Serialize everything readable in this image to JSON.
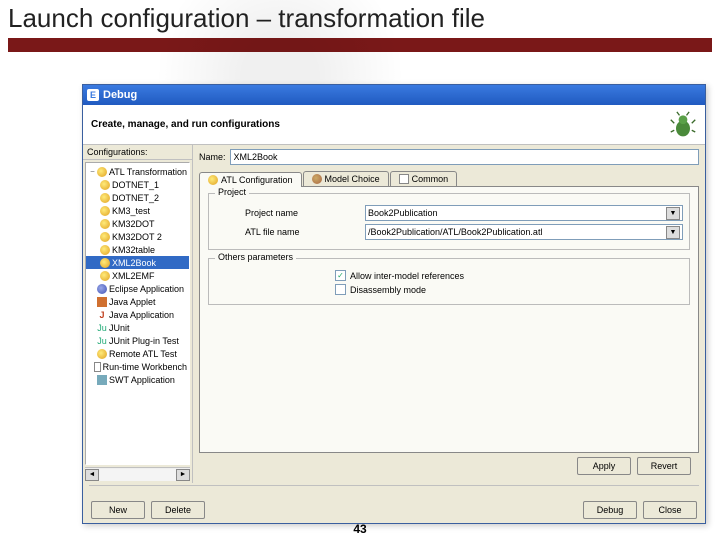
{
  "slide": {
    "title": "Launch configuration – transformation file",
    "page_number": "43"
  },
  "dialog": {
    "title": "Debug",
    "header": "Create, manage, and run configurations",
    "left": {
      "heading": "Configurations:",
      "tree": [
        {
          "label": "ATL Transformation",
          "children": [
            "DOTNET_1",
            "DOTNET_2",
            "KM3_test",
            "KM32DOT",
            "KM32DOT 2",
            "KM32table",
            "XML2Book",
            "XML2EMF"
          ]
        },
        {
          "label": "Eclipse Application"
        },
        {
          "label": "Java Applet"
        },
        {
          "label": "Java Application"
        },
        {
          "label": "JUnit"
        },
        {
          "label": "JUnit Plug-in Test"
        },
        {
          "label": "Remote ATL Test"
        },
        {
          "label": "Run-time Workbench"
        },
        {
          "label": "SWT Application"
        }
      ],
      "selected": "XML2Book"
    },
    "form": {
      "name_label": "Name:",
      "name_value": "XML2Book",
      "tabs": {
        "atl": "ATL Configuration",
        "model": "Model Choice",
        "common": "Common"
      },
      "project_group": "Project",
      "project_name_label": "Project name",
      "project_name_value": "Book2Publication",
      "atl_file_label": "ATL file name",
      "atl_file_value": "/Book2Publication/ATL/Book2Publication.atl",
      "other_group": "Others parameters",
      "chk1": "Allow inter-model references",
      "chk2": "Disassembly mode"
    },
    "buttons": {
      "new": "New",
      "delete": "Delete",
      "apply": "Apply",
      "revert": "Revert",
      "debug": "Debug",
      "close": "Close"
    }
  }
}
